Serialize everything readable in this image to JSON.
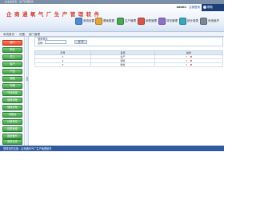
{
  "window": {
    "title": "企业级应用 - 生产管理软件"
  },
  "header": {
    "app_title": "企 商 通 氧 气 厂 生 产 管 理 软 件",
    "user_label": "admin",
    "logout_label": "注销登录",
    "corner_label": "帮助"
  },
  "toolbar": {
    "items": [
      {
        "label": "系统设置",
        "icon": "settings-icon",
        "color": "#4d8ad6"
      },
      {
        "label": "基础数据",
        "icon": "data-icon",
        "color": "#e6a53a"
      },
      {
        "label": "生产管理",
        "icon": "production-icon",
        "color": "#4aa755"
      },
      {
        "label": "销售管理",
        "icon": "sales-icon",
        "color": "#d95448"
      },
      {
        "label": "财务管理",
        "icon": "finance-icon",
        "color": "#8e6fc8"
      },
      {
        "label": "统计报表",
        "icon": "report-icon",
        "color": "#3aa6b9"
      },
      {
        "label": "系统维护",
        "icon": "maintenance-icon",
        "color": "#7a8796"
      }
    ]
  },
  "breadcrumb": {
    "home": "系统首页",
    "section": "设置",
    "current": "部门管理"
  },
  "sidebar": {
    "items": [
      {
        "label": "部门",
        "active": true
      },
      {
        "label": "职位"
      },
      {
        "label": "员工"
      },
      {
        "label": "客户"
      },
      {
        "label": "产品"
      },
      {
        "label": "钢瓶"
      },
      {
        "label": "车辆"
      },
      {
        "label": "气体种类"
      },
      {
        "label": "钢瓶规格"
      },
      {
        "label": "钢瓶类型"
      },
      {
        "label": "充装台"
      },
      {
        "label": "计量单位"
      },
      {
        "label": "权限管理"
      },
      {
        "label": "数据备份"
      },
      {
        "label": "系统日志"
      }
    ]
  },
  "search": {
    "panel_title": "搜索条件",
    "label": "名称:",
    "value": "",
    "placeholder": "",
    "button_label": "搜 索"
  },
  "table": {
    "columns": [
      "序号",
      "名称",
      "操作"
    ],
    "rows": [
      {
        "index": "1",
        "name": "生产",
        "edit": "修改",
        "delete": "删除"
      },
      {
        "index": "2",
        "name": "销售",
        "edit": "修改",
        "delete": "删除"
      },
      {
        "index": "3",
        "name": "财务",
        "edit": "修改",
        "delete": "删除"
      }
    ]
  },
  "footer": {
    "text": "您现在的位置：企商通氧气厂生产管理软件"
  }
}
